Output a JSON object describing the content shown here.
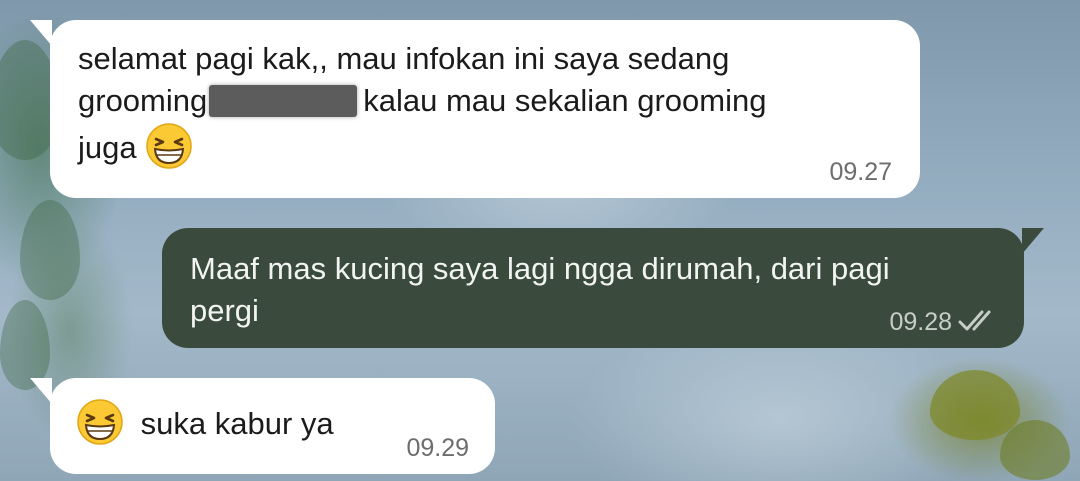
{
  "messages": [
    {
      "direction": "incoming",
      "line1": "selamat pagi kak,, mau infokan ini saya sedang",
      "line2_before": "grooming",
      "line2_after": "kalau mau sekalian grooming",
      "line3": "juga",
      "emoji": "grinning-squinting-face",
      "time": "09.27"
    },
    {
      "direction": "outgoing",
      "line1": "Maaf mas kucing saya lagi ngga dirumah, dari pagi",
      "line2": "pergi",
      "time": "09.28",
      "status": "read-double-check"
    },
    {
      "direction": "incoming",
      "emoji": "grinning-squinting-face",
      "text": "suka kabur ya",
      "time": "09.29"
    }
  ],
  "colors": {
    "incoming_bubble": "#ffffff",
    "outgoing_bubble": "#3a4a3c",
    "timestamp": "#6d6d6d"
  }
}
